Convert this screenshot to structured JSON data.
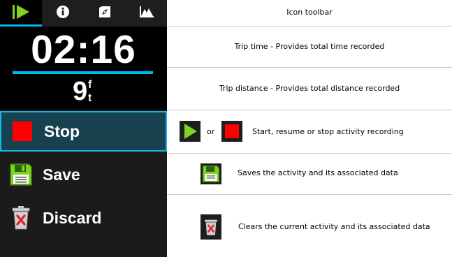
{
  "device": {
    "toolbar": {
      "tabs": [
        {
          "name": "play-icon",
          "active": true
        },
        {
          "name": "info-icon",
          "active": false
        },
        {
          "name": "compass-icon",
          "active": false
        },
        {
          "name": "elevation-icon",
          "active": false
        }
      ]
    },
    "trip_time": "02:16",
    "trip_distance": "9",
    "distance_unit_top": "f",
    "distance_unit_bottom": "t",
    "menu": [
      {
        "label": "Stop",
        "icon": "stop-icon",
        "selected": true
      },
      {
        "label": "Save",
        "icon": "floppy-disk-icon",
        "selected": false
      },
      {
        "label": "Discard",
        "icon": "trash-icon",
        "selected": false
      }
    ]
  },
  "descriptions": {
    "toolbar": "Icon toolbar",
    "trip_time": "Trip time - Provides total time recorded",
    "trip_distance": "Trip distance - Provides total distance recorded",
    "record_or": "or",
    "record": "Start, resume or stop activity recording",
    "save": "Saves the activity and its associated data",
    "discard": "Clears the current activity and its associated data"
  },
  "colors": {
    "accent": "#00b9f2",
    "play_green": "#7ed321",
    "stop_red": "#ff0000",
    "selected_bg": "#17414f"
  }
}
